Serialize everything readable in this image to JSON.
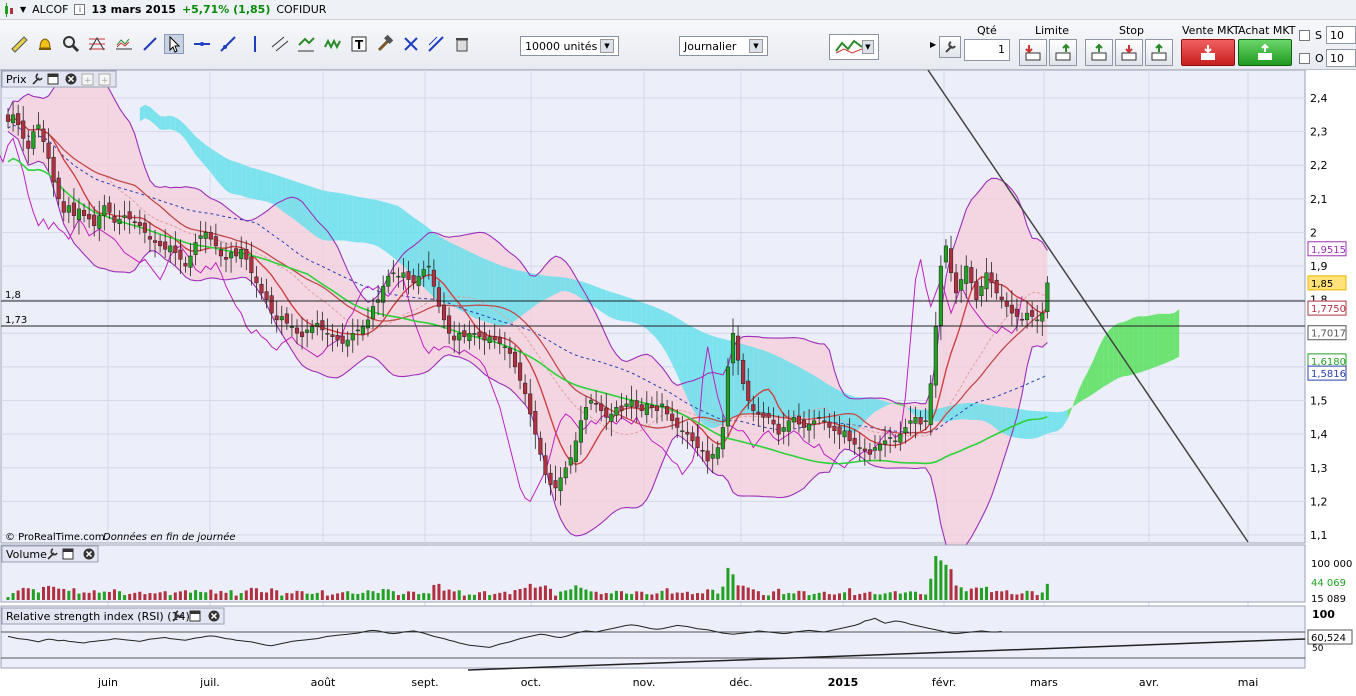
{
  "header": {
    "ticker": "ALCOF",
    "info_icon": "i",
    "date": "13 mars 2015",
    "change": "+5,71% (1,85)",
    "broker": "COFIDUR"
  },
  "toolbar": {
    "units_select": "10000 unités",
    "period_select": "Journalier",
    "qty_label": "Qté",
    "qty_value": "1",
    "limit_label": "Limite",
    "stop_label": "Stop",
    "sell_mkt_label": "Vente MKT",
    "buy_mkt_label": "Achat MKT",
    "s_label": "S",
    "s_value": "10",
    "o_label": "O",
    "o_value": "10",
    "icons": [
      "ruler-icon",
      "alarm-icon",
      "zoom-icon",
      "fib-icon",
      "fan-icon",
      "line-icon",
      "cursor-icon",
      "hline-icon",
      "trendline-icon",
      "vline-icon",
      "channel-icon",
      "pitchfork-icon",
      "wave-icon",
      "text-icon",
      "hammer-icon",
      "cross-icon",
      "ray-icon",
      "trash-icon"
    ]
  },
  "colors": {
    "up_candle": "#22a022",
    "down_candle": "#b03040",
    "kumo_bull": "#57e05c",
    "kumo_bear": "#68e0ec",
    "bollinger": "#9d2fb8",
    "bollinger_fill": "#f6cdd9",
    "panel_bg": "#eceef9"
  },
  "panels": {
    "price_title": "Prix",
    "copyright": "© ProRealTime.com",
    "data_note": "Données en fin de journée",
    "volume_title": "Volume",
    "rsi_title": "Relative strength index (RSI) (14)"
  },
  "chart_data": [
    {
      "type": "candlestick",
      "title": "Prix",
      "x_months": [
        "juin",
        "juil.",
        "août",
        "sept.",
        "oct.",
        "nov.",
        "déc.",
        "2015",
        "févr.",
        "mars",
        "avr.",
        "mai"
      ],
      "y_ticks": [
        "2,4",
        "2,3",
        "2,2",
        "2,1",
        "2",
        "1,9",
        "1,8",
        "1,7",
        "1,6",
        "1,5",
        "1,4",
        "1,3",
        "1,2",
        "1,1"
      ],
      "ylim": [
        1.1,
        2.4
      ],
      "h_lines": [
        {
          "label": "1,8",
          "value": 1.8
        },
        {
          "label": "1,73",
          "value": 1.73
        }
      ],
      "price_tags": [
        {
          "label": "1,9515",
          "value": 1.9515,
          "color": "#9d2fb8"
        },
        {
          "label": "1,85",
          "value": 1.85,
          "color": "#e8b400"
        },
        {
          "label": "1,7750",
          "value": 1.775,
          "color": "#b03040"
        },
        {
          "label": "1,7017",
          "value": 1.7017,
          "color": "#555555"
        },
        {
          "label": "1,6180",
          "value": 1.618,
          "color": "#22a022"
        },
        {
          "label": "1,5816",
          "value": 1.5816,
          "color": "#2a3fb0"
        }
      ],
      "close": [
        2.33,
        2.35,
        2.32,
        2.28,
        2.25,
        2.3,
        2.32,
        2.27,
        2.22,
        2.15,
        2.1,
        2.06,
        2.08,
        2.05,
        2.07,
        2.05,
        2.04,
        2.02,
        2.05,
        2.08,
        2.06,
        2.03,
        2.04,
        2.05,
        2.04,
        2.03,
        2.02,
        2.0,
        1.98,
        1.97,
        1.96,
        1.95,
        1.96,
        1.94,
        1.92,
        1.9,
        1.93,
        1.97,
        1.99,
        2.0,
        1.98,
        1.96,
        1.93,
        1.92,
        1.94,
        1.93,
        1.95,
        1.92,
        1.88,
        1.85,
        1.82,
        1.8,
        1.76,
        1.74,
        1.75,
        1.73,
        1.72,
        1.7,
        1.69,
        1.71,
        1.72,
        1.73,
        1.71,
        1.7,
        1.69,
        1.68,
        1.67,
        1.68,
        1.7,
        1.71,
        1.72,
        1.74,
        1.78,
        1.8,
        1.84,
        1.87,
        1.88,
        1.87,
        1.88,
        1.86,
        1.85,
        1.87,
        1.89,
        1.9,
        1.84,
        1.78,
        1.74,
        1.7,
        1.68,
        1.7,
        1.69,
        1.7,
        1.7,
        1.69,
        1.68,
        1.69,
        1.68,
        1.67,
        1.66,
        1.64,
        1.6,
        1.56,
        1.52,
        1.46,
        1.4,
        1.34,
        1.28,
        1.25,
        1.24,
        1.27,
        1.3,
        1.33,
        1.38,
        1.44,
        1.48,
        1.5,
        1.49,
        1.47,
        1.45,
        1.46,
        1.48,
        1.47,
        1.49,
        1.5,
        1.48,
        1.47,
        1.49,
        1.48,
        1.47,
        1.49,
        1.46,
        1.44,
        1.42,
        1.41,
        1.4,
        1.38,
        1.36,
        1.35,
        1.32,
        1.34,
        1.36,
        1.42,
        1.6,
        1.7,
        1.62,
        1.55,
        1.5,
        1.47,
        1.46,
        1.45,
        1.45,
        1.43,
        1.4,
        1.42,
        1.44,
        1.45,
        1.43,
        1.42,
        1.43,
        1.44,
        1.45,
        1.44,
        1.42,
        1.41,
        1.4,
        1.41,
        1.38,
        1.37,
        1.36,
        1.35,
        1.34,
        1.36,
        1.37,
        1.38,
        1.39,
        1.38,
        1.4,
        1.42,
        1.44,
        1.45,
        1.43,
        1.44,
        1.55,
        1.72,
        1.9,
        1.96,
        1.88,
        1.82,
        1.86,
        1.9,
        1.85,
        1.8,
        1.84,
        1.88,
        1.85,
        1.82,
        1.8,
        1.78,
        1.76,
        1.75,
        1.74,
        1.76,
        1.75,
        1.74,
        1.76,
        1.85
      ],
      "volume_ticks": [
        "100 000",
        "44 069",
        "15 089"
      ],
      "volume_last": 44069
    },
    {
      "type": "line",
      "title": "Relative strength index (RSI) (14)",
      "y_ticks": [
        "100",
        "50"
      ],
      "ylim": [
        0,
        100
      ],
      "last_value_label": "60,524",
      "values": [
        52,
        50,
        48,
        47,
        46,
        44,
        42,
        45,
        47,
        46,
        44,
        45,
        43,
        42,
        41,
        40,
        42,
        43,
        44,
        45,
        46,
        48,
        47,
        46,
        45,
        44,
        43,
        45,
        47,
        48,
        49,
        50,
        48,
        47,
        46,
        45,
        47,
        49,
        50,
        52,
        53,
        52,
        50,
        48,
        47,
        45,
        44,
        43,
        42,
        40,
        38,
        36,
        35,
        37,
        39,
        41,
        43,
        44,
        45,
        46,
        47,
        48,
        50,
        52,
        53,
        54,
        55,
        56,
        57,
        58,
        60,
        62,
        63,
        62,
        60,
        58,
        57,
        58,
        60,
        61,
        62,
        60,
        58,
        55,
        52,
        50,
        48,
        45,
        43,
        40,
        38,
        36,
        35,
        34,
        33,
        32,
        35,
        38,
        40,
        42,
        45,
        48,
        50,
        52,
        54,
        56,
        55,
        53,
        51,
        50,
        52,
        55,
        58,
        60,
        62,
        61,
        60,
        62,
        64,
        66,
        68,
        70,
        72,
        73,
        72,
        70,
        68,
        66,
        65,
        66,
        68,
        70,
        72,
        71,
        70,
        68,
        66,
        65,
        64,
        62,
        60,
        58,
        57,
        56,
        57,
        58,
        59,
        60,
        62,
        61,
        60,
        59,
        58,
        57,
        58,
        60,
        61,
        62,
        63,
        62,
        61,
        60,
        62,
        64,
        66,
        68,
        70,
        72,
        75,
        80,
        82,
        85,
        80,
        76,
        78,
        80,
        79,
        77,
        74,
        72,
        70,
        68,
        66,
        64,
        62,
        60,
        58,
        57,
        58,
        59,
        60,
        61,
        62,
        61,
        60,
        60,
        61
      ]
    }
  ]
}
